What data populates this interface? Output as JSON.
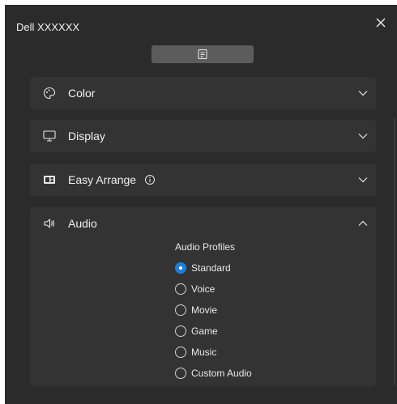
{
  "window": {
    "title": "Dell XXXXXX"
  },
  "sections": [
    {
      "label": "Color",
      "icon": "palette-icon",
      "expanded": false
    },
    {
      "label": "Display",
      "icon": "monitor-icon",
      "expanded": false
    },
    {
      "label": "Easy Arrange",
      "icon": "easy-arrange-icon",
      "expanded": false,
      "info": true
    },
    {
      "label": "Audio",
      "icon": "speaker-icon",
      "expanded": true
    }
  ],
  "audio": {
    "heading": "Audio Profiles",
    "selected": "Standard",
    "options": [
      "Standard",
      "Voice",
      "Movie",
      "Game",
      "Music",
      "Custom Audio"
    ]
  },
  "colors": {
    "background": "#2b2b2b",
    "panel": "#333333",
    "accent": "#1e7fdc",
    "menu_button": "#5c5c5c"
  }
}
